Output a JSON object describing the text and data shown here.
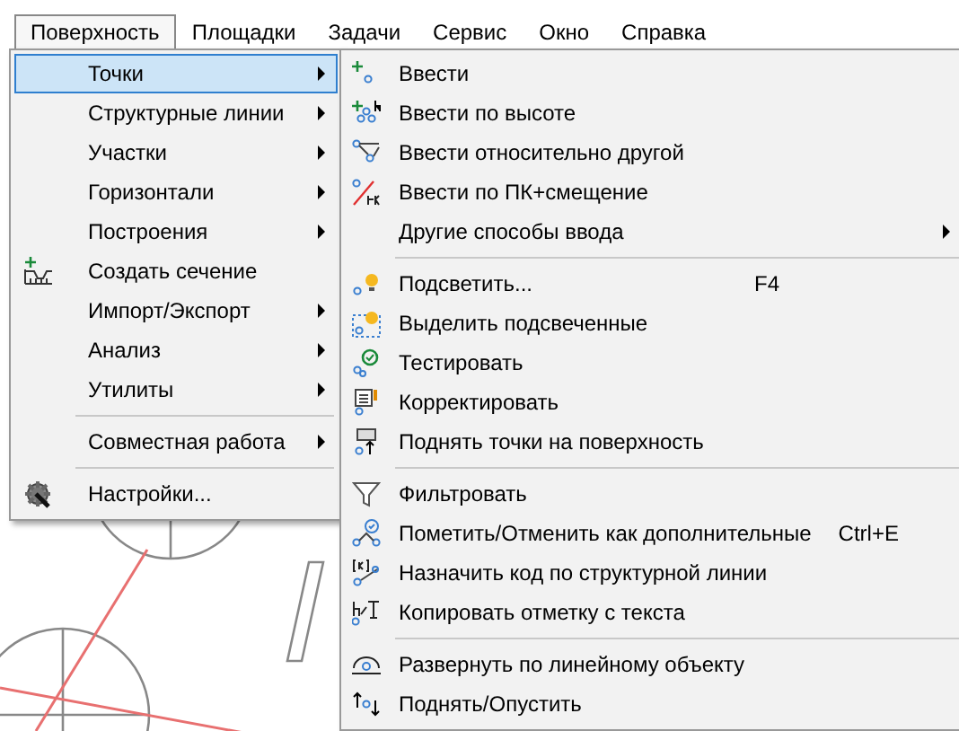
{
  "menubar": [
    {
      "label": "Поверхность",
      "selected": true
    },
    {
      "label": "Площадки",
      "selected": false
    },
    {
      "label": "Задачи",
      "selected": false
    },
    {
      "label": "Сервис",
      "selected": false
    },
    {
      "label": "Окно",
      "selected": false
    },
    {
      "label": "Справка",
      "selected": false
    }
  ],
  "menu": [
    {
      "kind": "item",
      "label": "Точки",
      "submenu": true,
      "selected": true
    },
    {
      "kind": "item",
      "label": "Структурные линии",
      "submenu": true,
      "selected": false
    },
    {
      "kind": "item",
      "label": "Участки",
      "submenu": true,
      "selected": false
    },
    {
      "kind": "item",
      "label": "Горизонтали",
      "submenu": true,
      "selected": false
    },
    {
      "kind": "item",
      "label": "Построения",
      "submenu": true,
      "selected": false
    },
    {
      "kind": "item",
      "label": "Создать сечение",
      "submenu": false,
      "selected": false
    },
    {
      "kind": "item",
      "label": "Импорт/Экспорт",
      "submenu": true,
      "selected": false
    },
    {
      "kind": "item",
      "label": "Анализ",
      "submenu": true,
      "selected": false
    },
    {
      "kind": "item",
      "label": "Утилиты",
      "submenu": true,
      "selected": false
    },
    {
      "kind": "separator"
    },
    {
      "kind": "item",
      "label": "Совместная работа",
      "submenu": true,
      "selected": false
    },
    {
      "kind": "separator"
    },
    {
      "kind": "item",
      "label": "Настройки...",
      "submenu": false,
      "selected": false
    }
  ],
  "submenu": [
    {
      "kind": "item",
      "label": "Ввести"
    },
    {
      "kind": "item",
      "label": "Ввести по высоте"
    },
    {
      "kind": "item",
      "label": "Ввести относительно другой"
    },
    {
      "kind": "item",
      "label": "Ввести по ПК+смещение"
    },
    {
      "kind": "item",
      "label": "Другие способы ввода",
      "submenu": true
    },
    {
      "kind": "separator"
    },
    {
      "kind": "item",
      "label": "Подсветить...",
      "shortcut": "F4"
    },
    {
      "kind": "item",
      "label": "Выделить подсвеченные"
    },
    {
      "kind": "item",
      "label": "Тестировать"
    },
    {
      "kind": "item",
      "label": "Корректировать"
    },
    {
      "kind": "item",
      "label": "Поднять точки на поверхность"
    },
    {
      "kind": "separator"
    },
    {
      "kind": "item",
      "label": "Фильтровать"
    },
    {
      "kind": "item",
      "label": "Пометить/Отменить как дополнительные",
      "shortcut": "Ctrl+E"
    },
    {
      "kind": "item",
      "label": "Назначить код по структурной линии"
    },
    {
      "kind": "item",
      "label": "Копировать отметку с текста"
    },
    {
      "kind": "separator"
    },
    {
      "kind": "item",
      "label": "Развернуть по линейному объекту"
    },
    {
      "kind": "item",
      "label": "Поднять/Опустить"
    }
  ]
}
